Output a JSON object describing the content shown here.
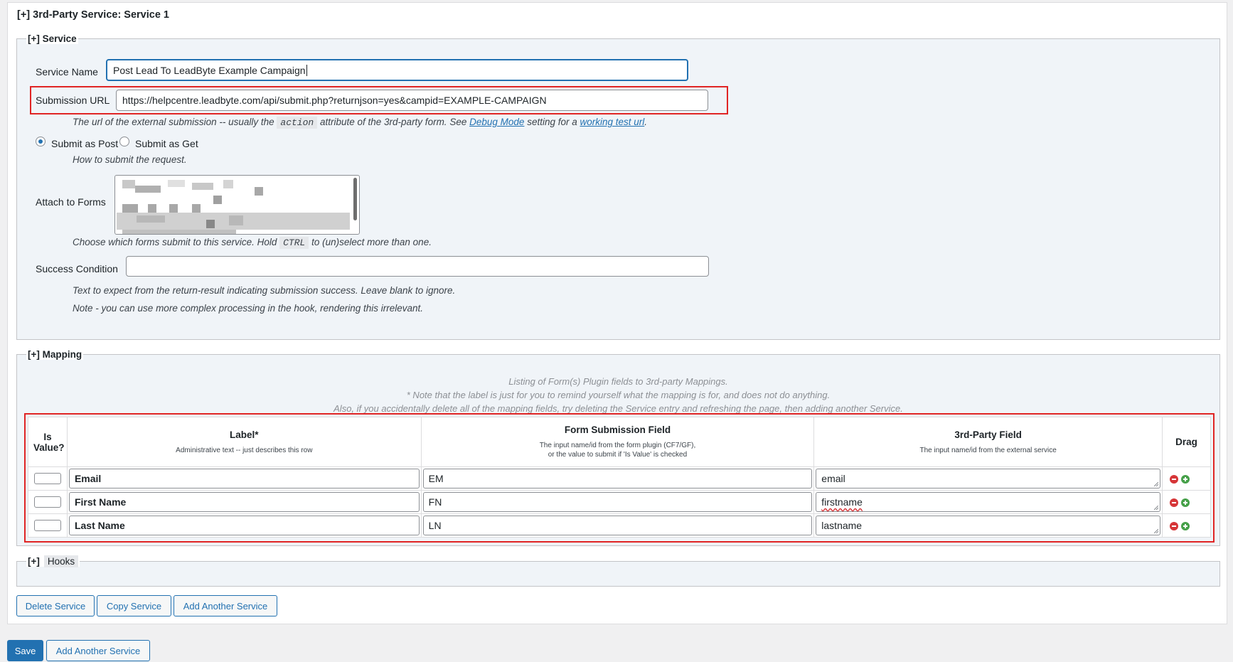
{
  "panel": {
    "title": "[+] 3rd-Party Service: Service 1"
  },
  "service": {
    "legend": "[+] Service",
    "name_label": "Service Name",
    "name_value": "Post Lead To LeadByte Example Campaign",
    "url_label": "Submission URL",
    "url_value": "https://helpcentre.leadbyte.com/api/submit.php?returnjson=yes&campid=EXAMPLE-CAMPAIGN",
    "url_desc_1": "The url of the external submission -- usually the",
    "url_desc_code": "action",
    "url_desc_2": "attribute of the 3rd-party form. See",
    "url_desc_link1": "Debug Mode",
    "url_desc_3": "setting for a",
    "url_desc_link2": "working test url",
    "url_desc_4": ".",
    "submit_post_label": "Submit as Post",
    "submit_get_label": "Submit as Get",
    "submit_post_selected": true,
    "method_desc": "How to submit the request.",
    "attach_label": "Attach to Forms",
    "attach_desc_1": "Choose which forms submit to this service. Hold",
    "attach_desc_code": "CTRL",
    "attach_desc_2": "to (un)select more than one.",
    "success_label": "Success Condition",
    "success_value": "",
    "success_desc_1": "Text to expect from the return-result indicating submission success. Leave blank to ignore.",
    "success_desc_2": "Note - you can use more complex processing in the hook, rendering this irrelevant."
  },
  "mapping": {
    "legend": "[+] Mapping",
    "note_1": "Listing of Form(s) Plugin fields to 3rd-party Mappings.",
    "note_2": "* Note that the label is just for you to remind yourself what the mapping is for, and does not do anything.",
    "note_3": "Also, if you accidentally delete all of the mapping fields, try deleting the Service entry and refreshing the page, then adding another Service.",
    "headers": {
      "is_value": "Is Value?",
      "label": "Label*",
      "label_sub": "Administrative text -- just describes this row",
      "form_field": "Form Submission Field",
      "form_field_sub_1": "The input name/id from the form plugin (CF7/GF),",
      "form_field_sub_2": "or the value to submit if 'Is Value' is checked",
      "third_party": "3rd-Party Field",
      "third_party_sub": "The input name/id from the external service",
      "drag": "Drag"
    },
    "rows": [
      {
        "label": "Email",
        "form_field": "EM",
        "third_party": "email"
      },
      {
        "label": "First Name",
        "form_field": "FN",
        "third_party": "firstname"
      },
      {
        "label": "Last Name",
        "form_field": "LN",
        "third_party": "lastname"
      }
    ]
  },
  "hooks": {
    "prefix": "[+]",
    "label": "Hooks"
  },
  "buttons": {
    "delete_service": "Delete Service",
    "copy_service": "Copy Service",
    "add_another_service": "Add Another Service",
    "save": "Save",
    "add_another_service_bottom": "Add Another Service"
  },
  "colors": {
    "accent": "#2271b1",
    "highlight": "#e02424",
    "remove": "#d63638",
    "add": "#46a049"
  }
}
